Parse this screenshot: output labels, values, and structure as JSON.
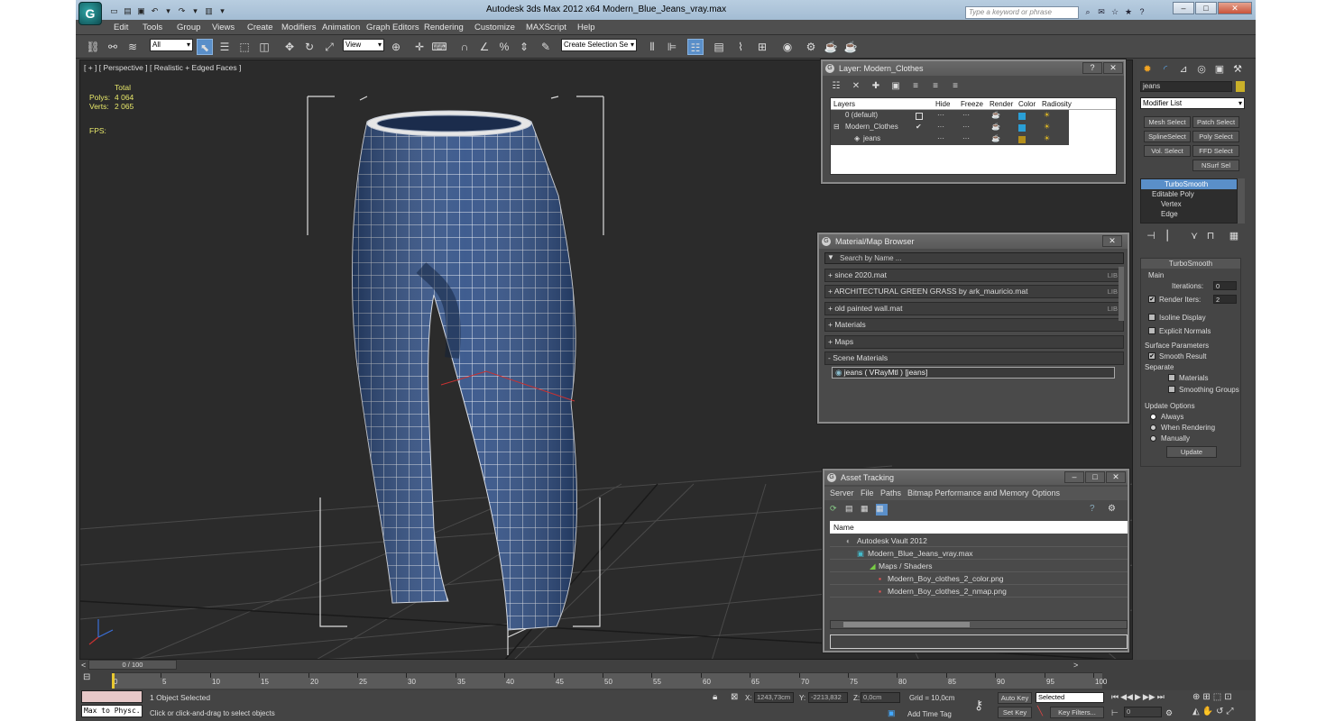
{
  "app": {
    "title": "Autodesk 3ds Max  2012 x64       Modern_Blue_Jeans_vray.max",
    "search_placeholder": "Type a keyword or phrase",
    "logo_glyph": "G"
  },
  "menu": [
    "Edit",
    "Tools",
    "Group",
    "Views",
    "Create",
    "Modifiers",
    "Animation",
    "Graph Editors",
    "Rendering",
    "Customize",
    "MAXScript",
    "Help"
  ],
  "toolbar": {
    "filter_value": "All",
    "ref_coord_value": "View",
    "selection_set_placeholder": "Create Selection Se"
  },
  "viewport": {
    "label": "[ + ] [ Perspective ] [ Realistic + Edged Faces ]",
    "stats": {
      "header": "Total",
      "polys_label": "Polys:",
      "polys_value": "4 064",
      "verts_label": "Verts:",
      "verts_value": "2 065",
      "fps_label": "FPS:"
    }
  },
  "layer_dialog": {
    "title": "Layer: Modern_Clothes",
    "columns": [
      "Layers",
      "Hide",
      "Freeze",
      "Render",
      "Color",
      "Radiosity"
    ],
    "rows": [
      {
        "name": "0 (default)",
        "color": "#2a9fd6"
      },
      {
        "name": "Modern_Clothes",
        "color": "#2a9fd6"
      },
      {
        "name": "jeans",
        "color": "#b58f1c"
      }
    ]
  },
  "material_browser": {
    "title": "Material/Map Browser",
    "search_placeholder": "Search by Name ...",
    "rows": [
      {
        "label": "+ since 2020.mat",
        "lib": "LIB"
      },
      {
        "label": "+ ARCHITECTURAL GREEN GRASS by ark_mauricio.mat",
        "lib": "LIB"
      },
      {
        "label": "+ old painted wall.mat",
        "lib": "LIB"
      },
      {
        "label": "+ Materials",
        "lib": ""
      },
      {
        "label": "+ Maps",
        "lib": ""
      },
      {
        "label": "- Scene Materials",
        "lib": ""
      }
    ],
    "scene_material": "jeans  ( VRayMtl ) [jeans]"
  },
  "asset_tracking": {
    "title": "Asset Tracking",
    "menu": [
      "Server",
      "File",
      "Paths",
      "Bitmap Performance and Memory",
      "Options"
    ],
    "column": "Name",
    "rows": [
      "Autodesk Vault 2012",
      "Modern_Blue_Jeans_vray.max",
      "Maps / Shaders",
      "Modern_Boy_clothes_2_color.png",
      "Modern_Boy_clothes_2_nmap.png"
    ]
  },
  "command_panel": {
    "object_name": "jeans",
    "modifier_list": "Modifier List",
    "buttons": [
      "Mesh Select",
      "Patch Select",
      "SplineSelect",
      "Poly Select",
      "Vol. Select",
      "FFD Select",
      "NSurf Sel"
    ],
    "stack": [
      "TurboSmooth",
      "Editable Poly",
      "Vertex",
      "Edge"
    ],
    "rollout_title": "TurboSmooth",
    "main_label": "Main",
    "iterations_label": "Iterations:",
    "iterations_value": "0",
    "render_iters_label": "Render Iters:",
    "render_iters_value": "2",
    "isoline_label": "Isoline Display",
    "explicit_label": "Explicit Normals",
    "surface_label": "Surface Parameters",
    "smooth_result_label": "Smooth Result",
    "separate_label": "Separate",
    "materials_label": "Materials",
    "smoothing_label": "Smoothing Groups",
    "update_options_label": "Update Options",
    "always_label": "Always",
    "when_rendering_label": "When Rendering",
    "manually_label": "Manually",
    "update_button": "Update"
  },
  "timeline": {
    "frame_counter": "0 / 100",
    "ticks": [
      "0",
      "5",
      "10",
      "15",
      "20",
      "25",
      "30",
      "35",
      "40",
      "45",
      "50",
      "55",
      "60",
      "65",
      "70",
      "75",
      "80",
      "85",
      "90",
      "95",
      "100"
    ]
  },
  "status": {
    "selection": "1 Object Selected",
    "prompt": "Click or click-and-drag to select objects",
    "maxscript": "Max to Physc.",
    "x_label": "X:",
    "x_value": "1243,73cm",
    "y_label": "Y:",
    "y_value": "-2213,832",
    "z_label": "Z:",
    "z_value": "0,0cm",
    "grid": "Grid = 10,0cm",
    "auto_key": "Auto Key",
    "selected": "Selected",
    "set_key": "Set Key",
    "key_filters": "Key Filters...",
    "add_time_tag": "Add Time Tag",
    "frame_value": "0"
  }
}
